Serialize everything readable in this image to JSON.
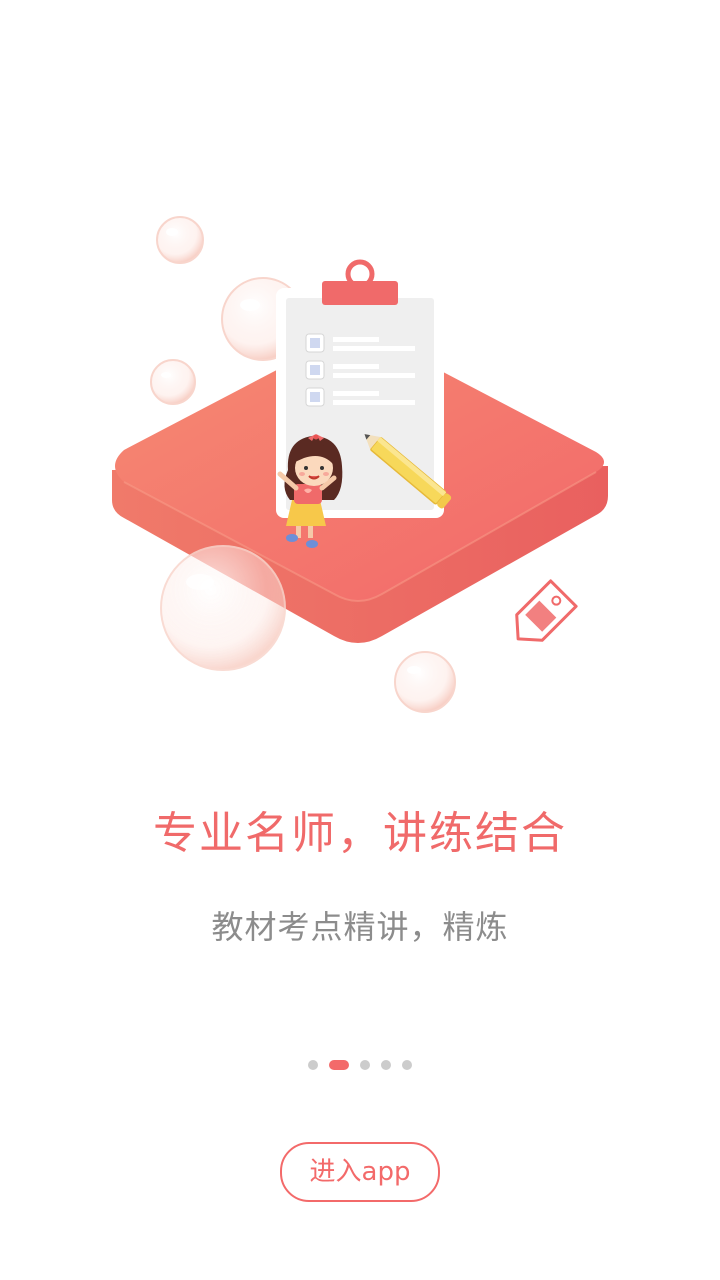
{
  "onboarding": {
    "title": "专业名师，讲练结合",
    "subtitle": "教材考点精讲，精炼",
    "page_indicator": {
      "total": 5,
      "current": 2
    },
    "enter_button_label": "进入app"
  },
  "colors": {
    "accent": "#f36a6a",
    "title_text": "#f06a6a",
    "subtitle_text": "#8c8c8c",
    "dot_inactive": "#cccccc",
    "platform_top": "#f47a6c",
    "platform_side": "#e8665e",
    "clipboard_board": "#ffffff",
    "clipboard_paper": "#efefef",
    "pencil": "#f7d85a",
    "bubble": "#fbe1da"
  },
  "icons": {
    "clipboard": "clipboard-icon",
    "pencil": "pencil-icon",
    "price_tag": "price-tag-icon",
    "girl": "girl-character",
    "bubble": "bubble-icon"
  }
}
